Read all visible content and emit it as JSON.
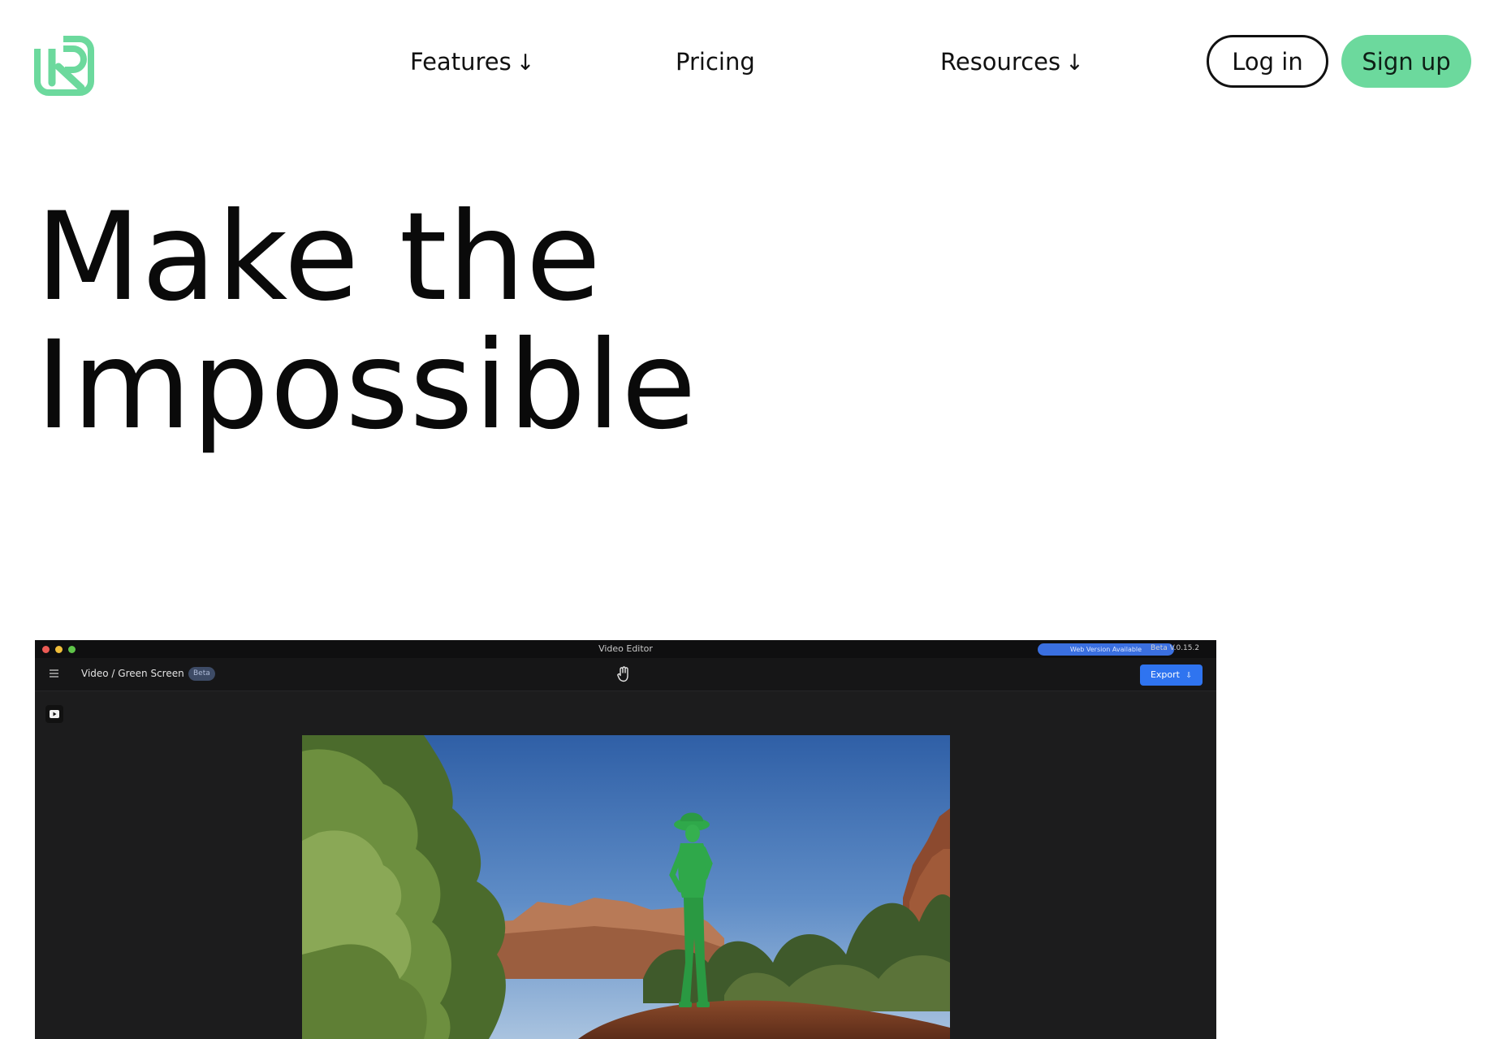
{
  "brand": {
    "logo_icon": "brand-logo-icon",
    "accent_color": "#6cd99d"
  },
  "nav": {
    "features_label": "Features",
    "pricing_label": "Pricing",
    "resources_label": "Resources",
    "arrow_glyph": "↓"
  },
  "auth": {
    "login_label": "Log in",
    "signup_label": "Sign up"
  },
  "hero": {
    "line1": "Make the",
    "line2": "Impossible"
  },
  "app_window": {
    "title": "Video Editor",
    "web_badge": "Web Version Available",
    "version": "Beta V.0.15.2",
    "breadcrumb": "Video / Green Screen",
    "beta_label": "Beta",
    "export_label": "Export",
    "export_color": "#2f74f0",
    "preview_subject_color": "#2fa84a"
  }
}
